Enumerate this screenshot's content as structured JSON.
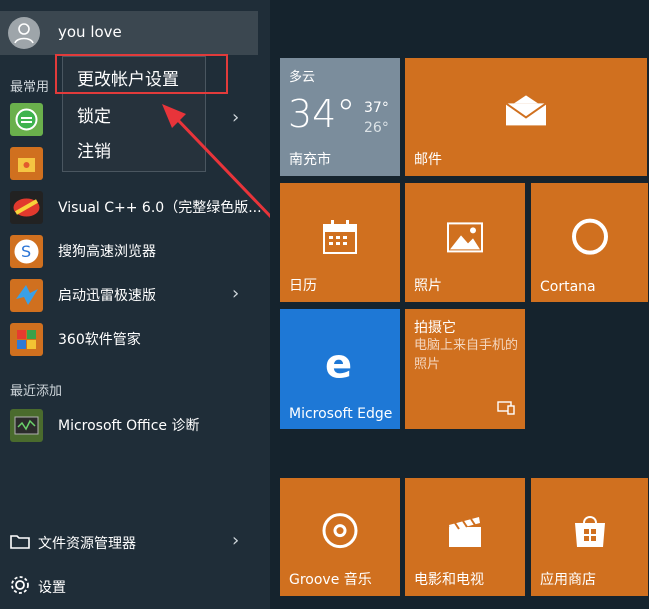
{
  "user": {
    "name": "you love"
  },
  "sections": {
    "most_used": "最常用",
    "recently_added": "最近添加"
  },
  "menu": {
    "items": [
      "更改帐户设置",
      "锁定",
      "注销"
    ]
  },
  "apps_most_used": [
    {
      "label": "",
      "icon": "green-circle-icon",
      "has_chevron": true
    },
    {
      "label": "",
      "icon": "yellow-box-icon",
      "has_chevron": false
    },
    {
      "label": "Visual C++ 6.0（完整绿色版...",
      "icon": "visual-cpp-icon",
      "has_chevron": false
    },
    {
      "label": "搜狗高速浏览器",
      "icon": "sogou-browser-icon",
      "has_chevron": false
    },
    {
      "label": "启动迅雷极速版",
      "icon": "xunlei-icon",
      "has_chevron": true
    },
    {
      "label": "360软件管家",
      "icon": "360-manager-icon",
      "has_chevron": false
    }
  ],
  "apps_recent": [
    {
      "label": "Microsoft Office 诊断",
      "icon": "office-diagnostic-icon"
    }
  ],
  "bottom": {
    "explorer": "文件资源管理器",
    "settings": "设置"
  },
  "weather": {
    "condition": "多云",
    "temp": "34°",
    "high": "37°",
    "low": "26°",
    "city": "南充市"
  },
  "tiles": {
    "mail": "邮件",
    "calendar": "日历",
    "photos": "照片",
    "cortana": "Cortana",
    "edge": "Microsoft Edge",
    "capture_title": "拍摄它",
    "capture_desc": "电脑上来自手机的照片",
    "groove": "Groove 音乐",
    "movies": "电影和电视",
    "store": "应用商店"
  },
  "colors": {
    "tile_orange": "#d0701f",
    "edge_blue": "#1e78d6",
    "weather": "#7b8d9c"
  }
}
